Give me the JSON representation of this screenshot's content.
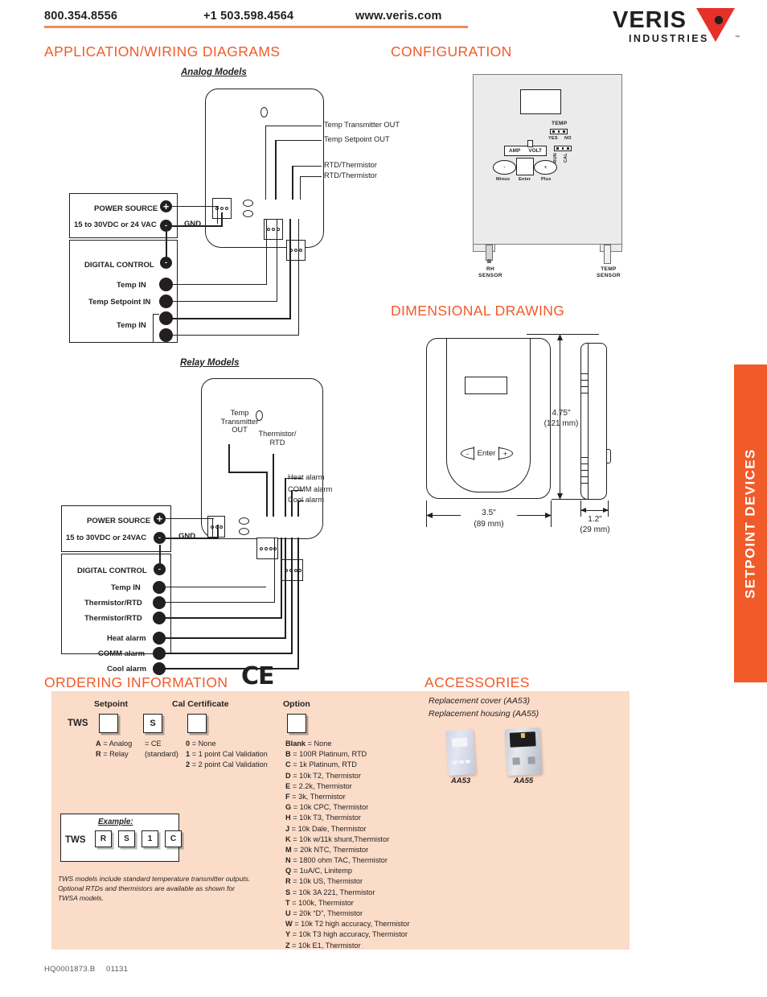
{
  "header": {
    "phone_us": "800.354.8556",
    "phone_intl": "+1 503.598.4564",
    "website": "www.veris.com",
    "logo_primary": "VERIS",
    "logo_secondary": "INDUSTRIES",
    "logo_tm": "™",
    "rule_color": "#F08A5D"
  },
  "side_tab": {
    "label": "SETPOINT DEVICES",
    "color": "#F15A29"
  },
  "sections": {
    "wiring_title": "APPLICATION/WIRING DIAGRAMS",
    "configuration_title": "CONFIGURATION",
    "dimensional_title": "DIMENSIONAL DRAWING",
    "ordering_title": "ORDERING INFORMATION",
    "accessories_title": "ACCESSORIES",
    "title_color": "#F15A29"
  },
  "analog": {
    "caption": "Analog Models",
    "power_source_line1": "POWER SOURCE",
    "power_source_line2": "15 to 30VDC or 24 VAC",
    "plus": "+",
    "minus": "-",
    "gnd": "GND",
    "digital_control": "DIGITAL CONTROL",
    "inputs": [
      "Temp IN",
      "Temp Setpoint IN",
      "Temp IN"
    ],
    "outputs": [
      "Temp Transmitter OUT",
      "Temp Setpoint OUT",
      "RTD/Thermistor",
      "RTD/Thermistor"
    ]
  },
  "relay": {
    "caption": "Relay Models",
    "power_source_line1": "POWER SOURCE",
    "power_source_line2": "15 to 30VDC or 24VAC",
    "plus": "+",
    "minus": "-",
    "gnd": "GND",
    "digital_control": "DIGITAL CONTROL",
    "dev_label_1_l1": "Temp",
    "dev_label_1_l2": "Transmitter",
    "dev_label_1_l3": "OUT",
    "dev_label_2_l1": "Thermistor/",
    "dev_label_2_l2": "RTD",
    "alarms": [
      "Heat alarm",
      "COMM alarm",
      "Cool alarm"
    ],
    "inputs": [
      "Temp IN",
      "Thermistor/RTD",
      "Thermistor/RTD"
    ],
    "alarm_terms": [
      "Heat alarm",
      "COMM alarm",
      "Cool alarm"
    ]
  },
  "configuration": {
    "temp_label": "TEMP",
    "yes": "YES",
    "no": "NO",
    "amp": "AMP",
    "volt": "VOLT",
    "run": "RUN",
    "cal": "CAL",
    "minus_sym": "-",
    "plus_sym": "+",
    "minus_label": "Minus",
    "enter_label": "Enter",
    "plus_label": "Plus",
    "rh_sensor_l1": "RH",
    "rh_sensor_l2": "SENSOR",
    "temp_sensor_l1": "TEMP",
    "temp_sensor_l2": "SENSOR"
  },
  "dimensional": {
    "height_in": "4.75\"",
    "height_mm": "(121 mm)",
    "width_in": "3.5\"",
    "width_mm": "(89 mm)",
    "depth_in": "1.2\"",
    "depth_mm": "(29 mm)",
    "enter_label": "Enter",
    "minus": "-",
    "plus": "+"
  },
  "ordering": {
    "ce_mark": "CE",
    "base_code": "TWS",
    "col_setpoint_header": "Setpoint",
    "col_cal_header": "Cal Certificate",
    "col_option_header": "Option",
    "setpoint_box_value": "",
    "setpoint_options": [
      {
        "code": "A",
        "desc": "= Analog"
      },
      {
        "code": "R",
        "desc": "= Relay"
      }
    ],
    "ce_box_value": "S",
    "ce_desc_line1": "= CE",
    "ce_desc_line2": "(standard)",
    "cal_box_value": "",
    "cal_options": [
      {
        "code": "0",
        "desc": "= None"
      },
      {
        "code": "1",
        "desc": "= 1 point Cal Validation"
      },
      {
        "code": "2",
        "desc": "= 2 point Cal Validation"
      }
    ],
    "option_box_value": "",
    "option_list": [
      {
        "code": "Blank",
        "desc": "= None"
      },
      {
        "code": "B",
        "desc": "= 100R Platinum, RTD"
      },
      {
        "code": "C",
        "desc": "= 1k Platinum, RTD"
      },
      {
        "code": "D",
        "desc": "= 10k T2, Thermistor"
      },
      {
        "code": "E",
        "desc": "= 2.2k, Thermistor"
      },
      {
        "code": "F",
        "desc": "= 3k, Thermistor"
      },
      {
        "code": "G",
        "desc": "= 10k CPC, Thermistor"
      },
      {
        "code": "H",
        "desc": "= 10k T3, Thermistor"
      },
      {
        "code": "J",
        "desc": "= 10k Dale, Thermistor"
      },
      {
        "code": "K",
        "desc": "= 10k w/11k  shunt,Thermistor"
      },
      {
        "code": "M",
        "desc": "= 20k NTC, Thermistor"
      },
      {
        "code": "N",
        "desc": "= 1800 ohm TAC, Thermistor"
      },
      {
        "code": "Q",
        "desc": "= 1uA/C, Linitemp"
      },
      {
        "code": "R",
        "desc": "= 10k US, Thermistor"
      },
      {
        "code": "S",
        "desc": "= 10k 3A 221, Thermistor"
      },
      {
        "code": "T",
        "desc": "= 100k, Thermistor"
      },
      {
        "code": "U",
        "desc": "= 20k “D”, Thermistor"
      },
      {
        "code": "W",
        "desc": "= 10k T2 high accuracy, Thermistor"
      },
      {
        "code": "Y",
        "desc": "= 10k T3 high accuracy, Thermistor"
      },
      {
        "code": "Z",
        "desc": "= 10k E1, Thermistor"
      }
    ],
    "example_title": "Example:",
    "example_base": "TWS",
    "example_codes": [
      "R",
      "S",
      "1",
      "C"
    ],
    "footnote": "TWS models include standard temperature transmitter outputs. Optional RTDs and thermistors are available as shown for TWSA models.",
    "panel_color": "#FADCC8"
  },
  "accessories": {
    "line1": "Replacement cover (AA53)",
    "line2": "Replacement housing (AA55)",
    "items": [
      {
        "caption": "AA53"
      },
      {
        "caption": "AA55"
      }
    ]
  },
  "footer": {
    "doc_id": "HQ0001873.B",
    "revision": "01131"
  }
}
